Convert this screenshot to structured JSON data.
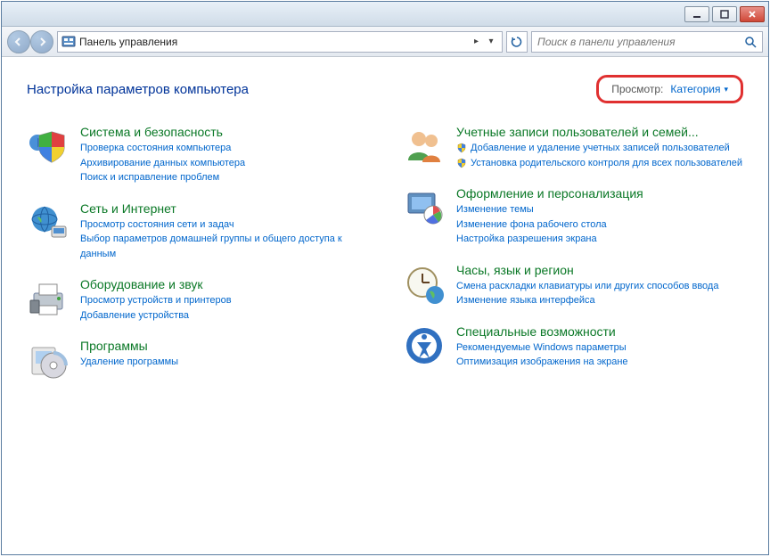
{
  "address": {
    "title": "Панель управления"
  },
  "search": {
    "placeholder": "Поиск в панели управления"
  },
  "header": {
    "title": "Настройка параметров компьютера",
    "view_label": "Просмотр:",
    "view_value": "Категория"
  },
  "left": [
    {
      "title": "Система и безопасность",
      "links": [
        "Проверка состояния компьютера",
        "Архивирование данных компьютера",
        "Поиск и исправление проблем"
      ],
      "icon": "shield-colors"
    },
    {
      "title": "Сеть и Интернет",
      "links": [
        "Просмотр состояния сети и задач",
        "Выбор параметров домашней группы и общего доступа к данным"
      ],
      "icon": "globe"
    },
    {
      "title": "Оборудование и звук",
      "links": [
        "Просмотр устройств и принтеров",
        "Добавление устройства"
      ],
      "icon": "printer"
    },
    {
      "title": "Программы",
      "links": [
        "Удаление программы"
      ],
      "icon": "cd-box"
    }
  ],
  "right": [
    {
      "title": "Учетные записи пользователей и семей...",
      "shield_links": [
        "Добавление и удаление учетных записей пользователей",
        "Установка родительского контроля для всех пользователей"
      ],
      "icon": "users"
    },
    {
      "title": "Оформление и персонализация",
      "links": [
        "Изменение темы",
        "Изменение фона рабочего стола",
        "Настройка разрешения экрана"
      ],
      "icon": "desktop-theme"
    },
    {
      "title": "Часы, язык и регион",
      "links": [
        "Смена раскладки клавиатуры или других способов ввода",
        "Изменение языка интерфейса"
      ],
      "icon": "clock-globe"
    },
    {
      "title": "Специальные возможности",
      "links": [
        "Рекомендуемые Windows параметры",
        "Оптимизация изображения на экране"
      ],
      "icon": "access"
    }
  ]
}
